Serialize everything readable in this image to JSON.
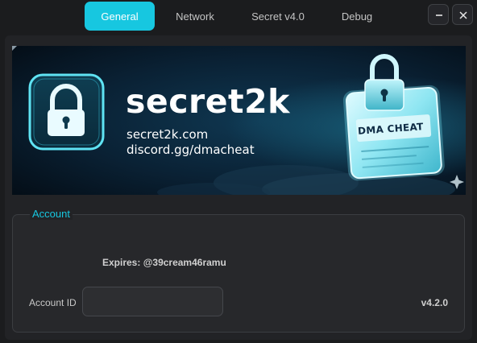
{
  "tabs": [
    {
      "label": "General",
      "active": true
    },
    {
      "label": "Network",
      "active": false
    },
    {
      "label": "Secret v4.0",
      "active": false
    },
    {
      "label": "Debug",
      "active": false
    }
  ],
  "window_controls": {
    "minimize": "minimize-icon",
    "close": "close-icon"
  },
  "banner": {
    "title": "secret2k",
    "website": "secret2k.com",
    "discord": "discord.gg/dmacheat",
    "badge_text": "DMA CHEAT"
  },
  "account": {
    "group_title": "Account",
    "expires_text": "Expires: @39cream46ramu",
    "id_label": "Account ID",
    "id_value": "",
    "version": "v4.2.0"
  },
  "colors": {
    "accent": "#17c7e0",
    "background": "#1b1c1e",
    "panel": "#27282b"
  }
}
